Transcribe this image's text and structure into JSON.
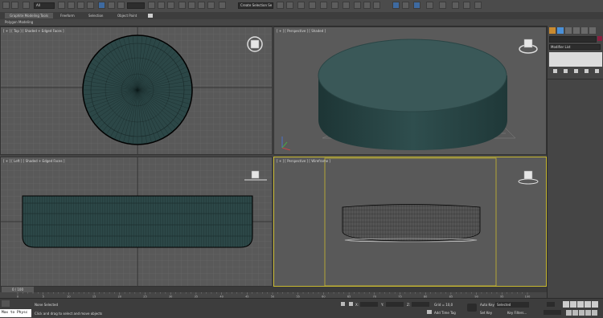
{
  "toolbar": {
    "selection_filter": "All",
    "create_selection_set": "Create Selection Se"
  },
  "ribbon": {
    "tabs": [
      "Graphite Modeling Tools",
      "Freeform",
      "Selection",
      "Object Paint"
    ],
    "sub": "Polygon Modeling"
  },
  "viewports": {
    "top_label": "[ + ] [ Top ] [ Shaded + Edged Faces ]",
    "persp_label": "[ + ] [ Perspective ] [ Shaded ]",
    "left_label": "[ + ] [ Left ] [ Shaded + Edged Faces ]",
    "persp_wire_label": "[ + ] [ Perspective ] [ Wireframe ]"
  },
  "command_panel": {
    "modifier_list": "Modifier List"
  },
  "timeline": {
    "frame": "0 / 100",
    "ticks": [
      "0",
      "5",
      "10",
      "15",
      "20",
      "25",
      "30",
      "35",
      "40",
      "45",
      "50",
      "55",
      "60",
      "65",
      "70",
      "75",
      "80",
      "85",
      "90",
      "95",
      "100"
    ]
  },
  "status": {
    "maxscript": "Max to Physc",
    "none_selected": "None Selected",
    "prompt": "Click and drag to select and move objects",
    "x_label": "X:",
    "y_label": "Y:",
    "z_label": "Z:",
    "grid": "Grid = 10,0",
    "add_time_tag": "Add Time Tag",
    "auto_key": "Auto Key",
    "auto_key_value": "Selected",
    "set_key": "Set Key",
    "key_filters": "Key Filters..."
  },
  "colors": {
    "viewport_bg": "#595959",
    "mesh": "#2c4747",
    "active_border": "#c8b830"
  }
}
